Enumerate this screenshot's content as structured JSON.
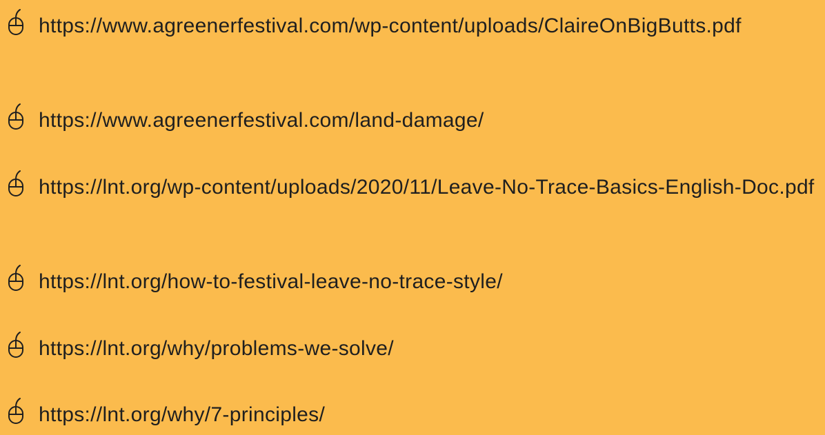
{
  "links": [
    {
      "icon": "computer-mouse-icon",
      "text": "https://www.agreenerfestival.com/wp-content/uploads/ClaireOnBigButts.pdf"
    },
    {
      "icon": "computer-mouse-icon",
      "text": "https://www.agreenerfestival.com/land-damage/"
    },
    {
      "icon": "computer-mouse-icon",
      "text": "https://lnt.org/wp-content/uploads/2020/11/Leave-No-Trace-Basics-English-Doc.pdf"
    },
    {
      "icon": "computer-mouse-icon",
      "text": "https://lnt.org/how-to-festival-leave-no-trace-style/"
    },
    {
      "icon": "computer-mouse-icon",
      "text": "https://lnt.org/why/problems-we-solve/"
    },
    {
      "icon": "computer-mouse-icon",
      "text": "https://lnt.org/why/7-principles/"
    }
  ],
  "colors": {
    "background": "#FBBB4D",
    "text": "#1F1F1F"
  }
}
